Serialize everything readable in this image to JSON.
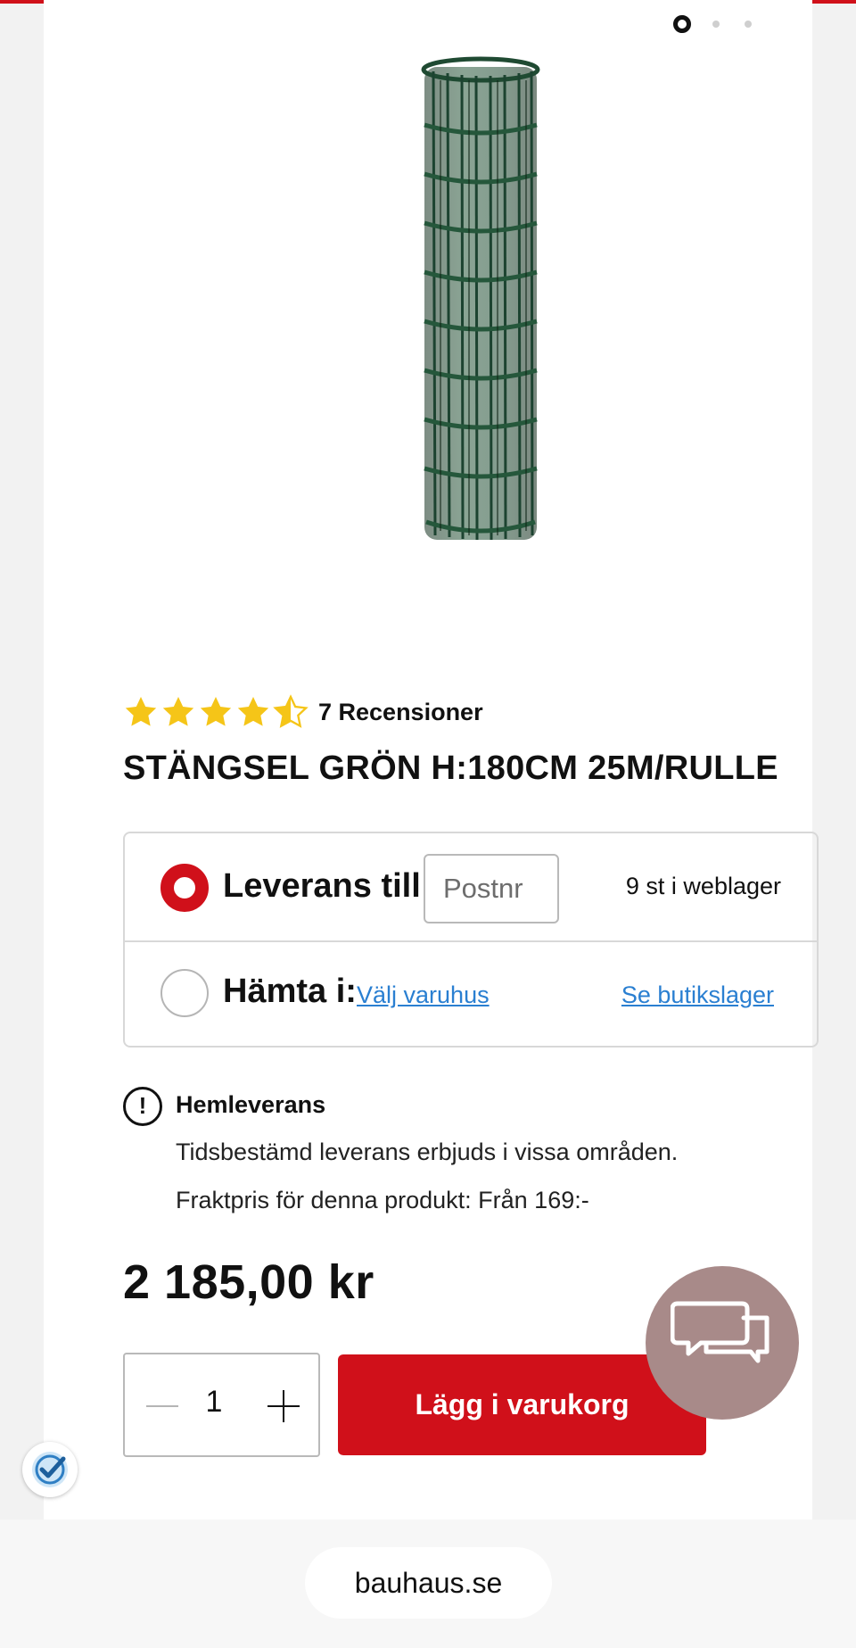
{
  "carousel": {
    "slides": 3,
    "active_index": 0
  },
  "product": {
    "image_name": "green-wire-fence-roll",
    "rating": 4.5,
    "review_count_text": "7 Recensioner",
    "title": "STÄNGSEL GRÖN H:180CM 25M/RULLE",
    "price": "2 185,00 kr"
  },
  "delivery": {
    "delivery_label": "Leverans till:",
    "postcode_placeholder": "Postnr",
    "stock_text": "9 st i weblager",
    "pickup_label": "Hämta i:",
    "choose_store_link": "Välj varuhus",
    "store_stock_link": "Se butikslager"
  },
  "home_delivery": {
    "title": "Hemleverans",
    "line1": "Tidsbestämd leverans erbjuds i vissa områden.",
    "line2": "Fraktpris för denna produkt: Från 169:-"
  },
  "cart": {
    "quantity": "1",
    "add_button": "Lägg i varukorg"
  },
  "browser": {
    "url": "bauhaus.se"
  },
  "colors": {
    "brand_red": "#d0101a",
    "link_blue": "#2a7fd1",
    "star_yellow": "#f5c518",
    "chat_bubble": "#a88a89",
    "fence_green": "#1f4a32"
  },
  "icons": [
    "star-icon",
    "info-icon",
    "minus-icon",
    "plus-icon",
    "chat-icon",
    "trust-check-icon"
  ]
}
